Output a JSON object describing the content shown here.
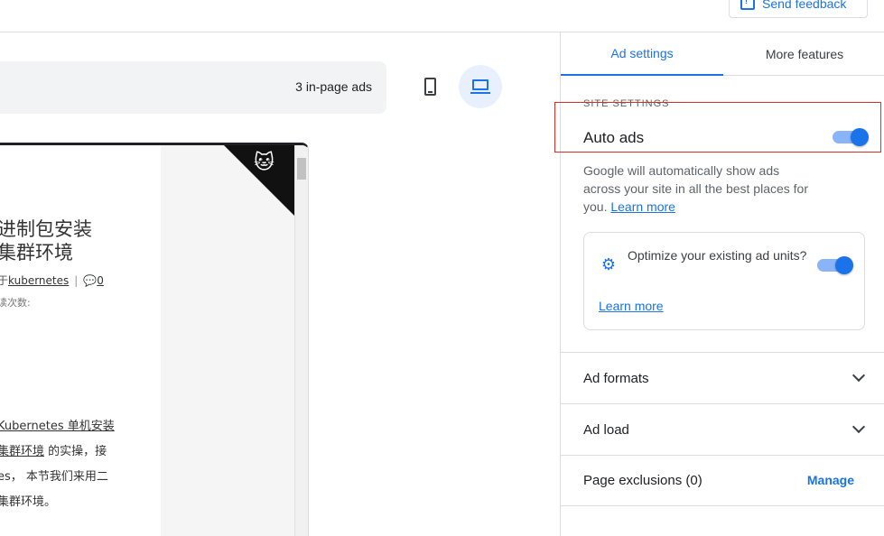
{
  "topbar": {
    "feedback_label": "Send feedback"
  },
  "preview": {
    "ads_count": "3 in-page ads",
    "site": {
      "title_line1": "进制包安装",
      "title_line2": "集群环境",
      "meta_prefix": "于",
      "meta_category": "kubernetes",
      "meta_comments": "0",
      "views_label": "读次数:",
      "body_line1": "Kubernetes 单机安装",
      "body_line2_link": "集群环境",
      "body_line2_rest": " 的实操，接",
      "body_line3": "es， 本节我们来用二",
      "body_line4": "集群环境。"
    }
  },
  "panel": {
    "tabs": {
      "ad_settings": "Ad settings",
      "more_features": "More features"
    },
    "section_label": "SITE SETTINGS",
    "auto_ads": {
      "label": "Auto ads",
      "enabled": true
    },
    "description": "Google will automatically show ads across your site in all the best places for you.",
    "learn_more": "Learn more",
    "optimize": {
      "text": "Optimize your existing ad units?",
      "enabled": true,
      "learn_more": "Learn more"
    },
    "ad_formats": "Ad formats",
    "ad_load": "Ad load",
    "page_exclusions": "Page exclusions (0)",
    "manage": "Manage"
  },
  "colors": {
    "accent": "#1a73e8",
    "highlight": "#d93025"
  }
}
